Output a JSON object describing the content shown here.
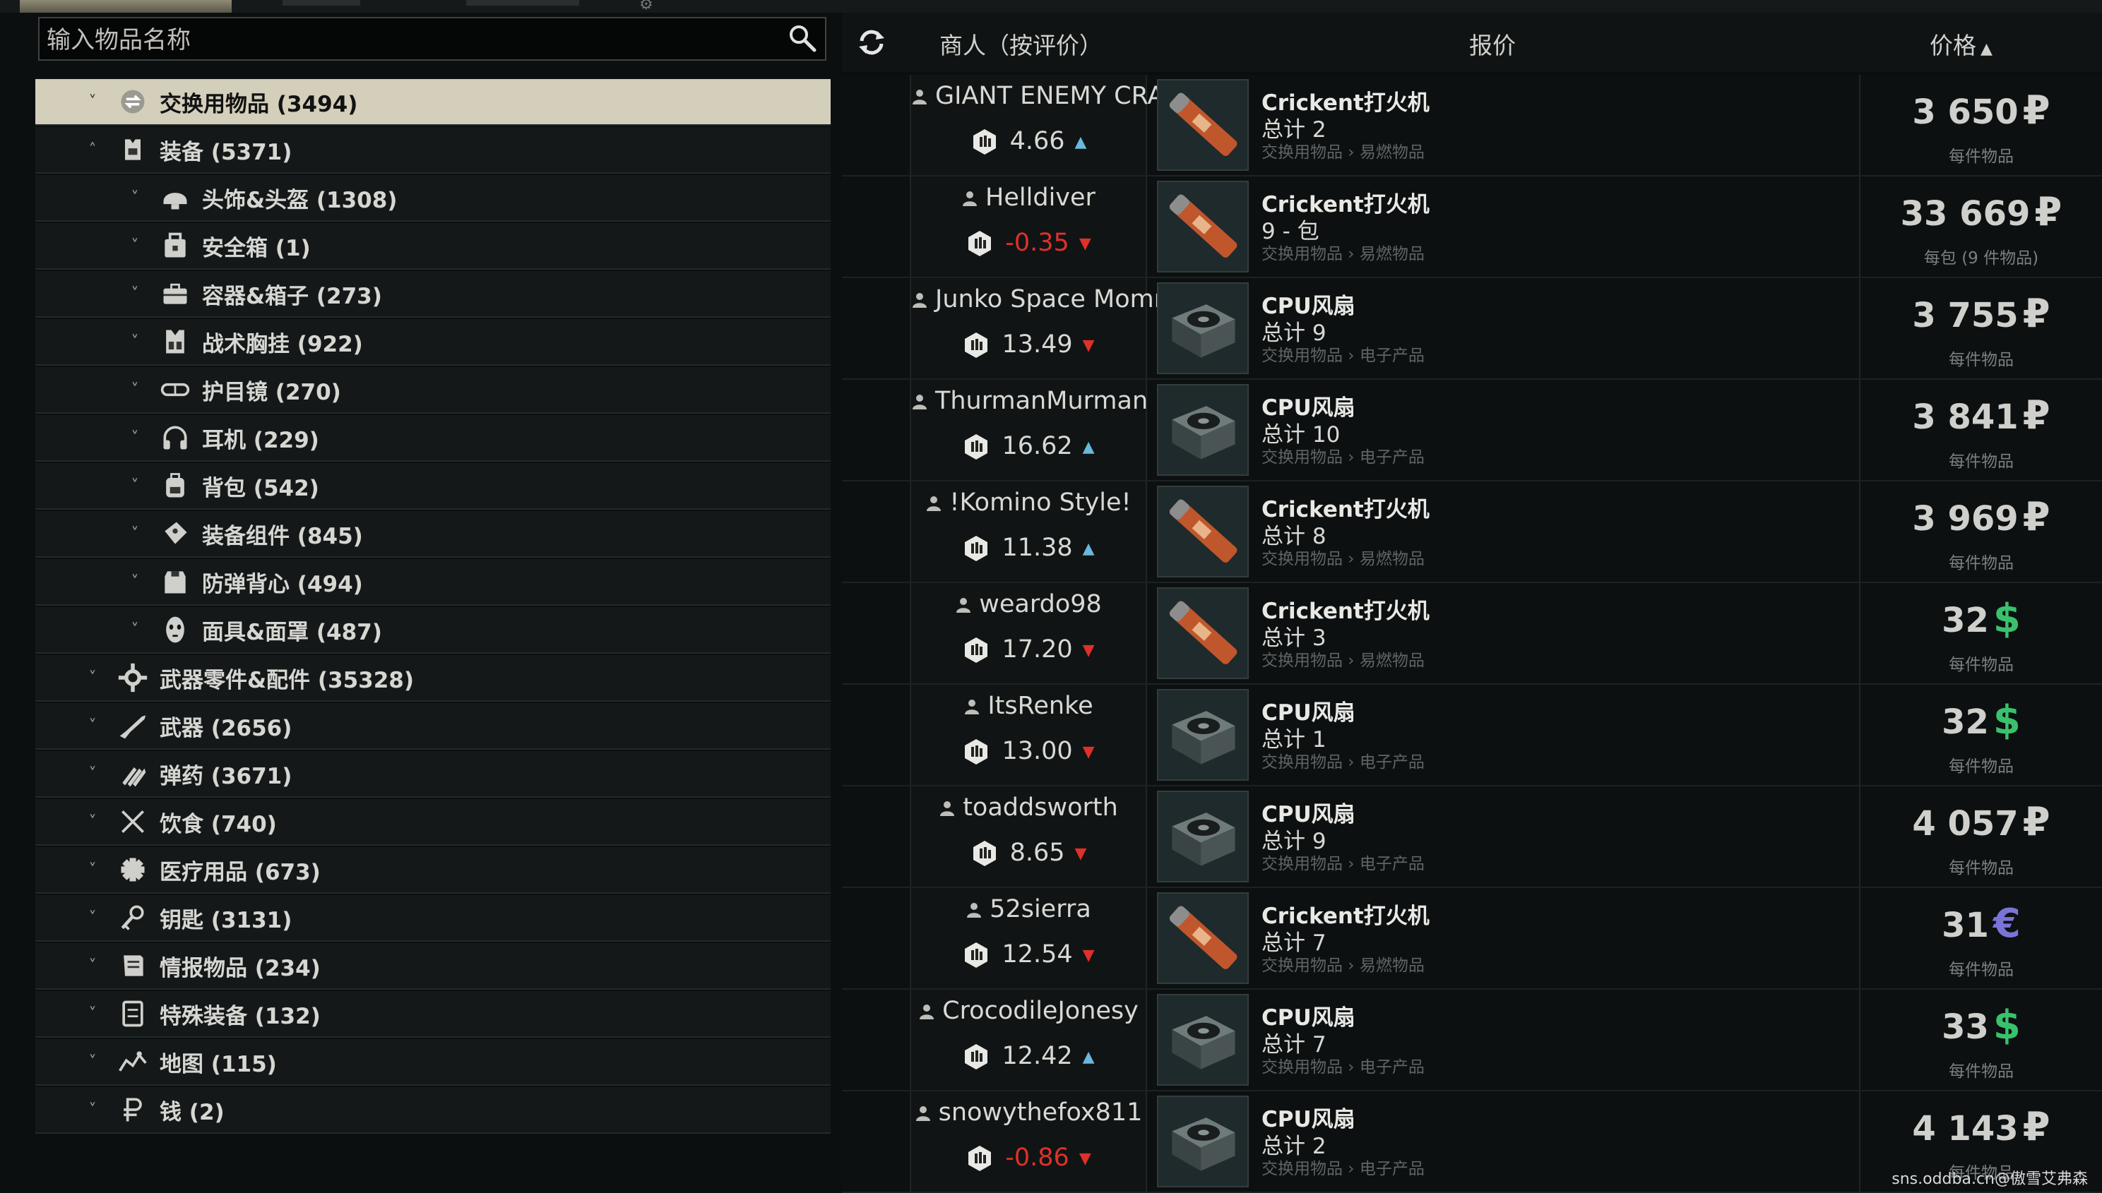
{
  "search": {
    "placeholder": "输入物品名称"
  },
  "categories": [
    {
      "label": "交换用物品 (3494)",
      "icon": "barter-icon",
      "level": 0,
      "expanded": true,
      "selected": true
    },
    {
      "label": "装备 (5371)",
      "icon": "gear-vest-icon",
      "level": 0,
      "expanded": true,
      "selected": false
    },
    {
      "label": "头饰&头盔 (1308)",
      "icon": "helmet-icon",
      "level": 1,
      "expanded": false,
      "selected": false
    },
    {
      "label": "安全箱 (1)",
      "icon": "secure-container-icon",
      "level": 1,
      "expanded": false,
      "selected": false
    },
    {
      "label": "容器&箱子 (273)",
      "icon": "case-icon",
      "level": 1,
      "expanded": false,
      "selected": false
    },
    {
      "label": "战术胸挂 (922)",
      "icon": "chest-rig-icon",
      "level": 1,
      "expanded": false,
      "selected": false
    },
    {
      "label": "护目镜 (270)",
      "icon": "goggles-icon",
      "level": 1,
      "expanded": false,
      "selected": false
    },
    {
      "label": "耳机 (229)",
      "icon": "headset-icon",
      "level": 1,
      "expanded": false,
      "selected": false
    },
    {
      "label": "背包 (542)",
      "icon": "backpack-icon",
      "level": 1,
      "expanded": false,
      "selected": false
    },
    {
      "label": "装备组件 (845)",
      "icon": "gear-component-icon",
      "level": 1,
      "expanded": false,
      "selected": false
    },
    {
      "label": "防弹背心 (494)",
      "icon": "armor-icon",
      "level": 1,
      "expanded": false,
      "selected": false
    },
    {
      "label": "面具&面罩 (487)",
      "icon": "mask-icon",
      "level": 1,
      "expanded": false,
      "selected": false
    },
    {
      "label": "武器零件&配件 (35328)",
      "icon": "weapon-parts-icon",
      "level": 0,
      "expanded": false,
      "selected": false
    },
    {
      "label": "武器 (2656)",
      "icon": "rifle-icon",
      "level": 0,
      "expanded": false,
      "selected": false
    },
    {
      "label": "弹药 (3671)",
      "icon": "ammo-icon",
      "level": 0,
      "expanded": false,
      "selected": false
    },
    {
      "label": "饮食 (740)",
      "icon": "food-icon",
      "level": 0,
      "expanded": false,
      "selected": false
    },
    {
      "label": "医疗用品 (673)",
      "icon": "medical-icon",
      "level": 0,
      "expanded": false,
      "selected": false
    },
    {
      "label": "钥匙 (3131)",
      "icon": "key-icon",
      "level": 0,
      "expanded": false,
      "selected": false
    },
    {
      "label": "情报物品 (234)",
      "icon": "intel-icon",
      "level": 0,
      "expanded": false,
      "selected": false
    },
    {
      "label": "特殊装备 (132)",
      "icon": "special-equipment-icon",
      "level": 0,
      "expanded": false,
      "selected": false
    },
    {
      "label": "地图 (115)",
      "icon": "map-icon",
      "level": 0,
      "expanded": false,
      "selected": false
    },
    {
      "label": "钱 (2)",
      "icon": "ruble-icon",
      "level": 0,
      "expanded": false,
      "selected": false
    }
  ],
  "header": {
    "merchant": "商人（按评价）",
    "offer": "报价",
    "price": "价格",
    "sort_arrow": "▲"
  },
  "offers": [
    {
      "seller": "GIANT ENEMY CRAB",
      "rating": "4.66",
      "trend": "up",
      "negative": false,
      "item": "Crickent打火机",
      "qty": "总计 2",
      "category": "交换用物品 › 易燃物品",
      "thumb": "lighter-thumb",
      "price": "3 650",
      "currency": "₽",
      "currency_kind": "rub",
      "unit": "每件物品"
    },
    {
      "seller": "Helldiver",
      "rating": "-0.35",
      "trend": "down",
      "negative": true,
      "item": "Crickent打火机",
      "qty": "9 - 包",
      "category": "交换用物品 › 易燃物品",
      "thumb": "lighter-thumb",
      "price": "33 669",
      "currency": "₽",
      "currency_kind": "rub",
      "unit": "每包 (9 件物品)"
    },
    {
      "seller": "Junko Space Mommy",
      "rating": "13.49",
      "trend": "down",
      "negative": false,
      "item": "CPU风扇",
      "qty": "总计 9",
      "category": "交换用物品 › 电子产品",
      "thumb": "cpu-fan-thumb",
      "price": "3 755",
      "currency": "₽",
      "currency_kind": "rub",
      "unit": "每件物品"
    },
    {
      "seller": "ThurmanMurman",
      "rating": "16.62",
      "trend": "up",
      "negative": false,
      "item": "CPU风扇",
      "qty": "总计 10",
      "category": "交换用物品 › 电子产品",
      "thumb": "cpu-fan-thumb",
      "price": "3 841",
      "currency": "₽",
      "currency_kind": "rub",
      "unit": "每件物品"
    },
    {
      "seller": "!Komino Style!",
      "rating": "11.38",
      "trend": "up",
      "negative": false,
      "item": "Crickent打火机",
      "qty": "总计 8",
      "category": "交换用物品 › 易燃物品",
      "thumb": "lighter-thumb",
      "price": "3 969",
      "currency": "₽",
      "currency_kind": "rub",
      "unit": "每件物品"
    },
    {
      "seller": "weardo98",
      "rating": "17.20",
      "trend": "down",
      "negative": false,
      "item": "Crickent打火机",
      "qty": "总计 3",
      "category": "交换用物品 › 易燃物品",
      "thumb": "lighter-thumb",
      "price": "32",
      "currency": "$",
      "currency_kind": "usd",
      "unit": "每件物品"
    },
    {
      "seller": "ItsRenke",
      "rating": "13.00",
      "trend": "down",
      "negative": false,
      "item": "CPU风扇",
      "qty": "总计 1",
      "category": "交换用物品 › 电子产品",
      "thumb": "cpu-fan-thumb",
      "price": "32",
      "currency": "$",
      "currency_kind": "usd",
      "unit": "每件物品"
    },
    {
      "seller": "toaddsworth",
      "rating": "8.65",
      "trend": "down",
      "negative": false,
      "item": "CPU风扇",
      "qty": "总计 9",
      "category": "交换用物品 › 电子产品",
      "thumb": "cpu-fan-thumb",
      "price": "4 057",
      "currency": "₽",
      "currency_kind": "rub",
      "unit": "每件物品"
    },
    {
      "seller": "52sierra",
      "rating": "12.54",
      "trend": "down",
      "negative": false,
      "item": "Crickent打火机",
      "qty": "总计 7",
      "category": "交换用物品 › 易燃物品",
      "thumb": "lighter-thumb",
      "price": "31",
      "currency": "€",
      "currency_kind": "eur",
      "unit": "每件物品"
    },
    {
      "seller": "CrocodileJonesy",
      "rating": "12.42",
      "trend": "up",
      "negative": false,
      "item": "CPU风扇",
      "qty": "总计 7",
      "category": "交换用物品 › 电子产品",
      "thumb": "cpu-fan-thumb",
      "price": "33",
      "currency": "$",
      "currency_kind": "usd",
      "unit": "每件物品"
    },
    {
      "seller": "snowythefox811",
      "rating": "-0.86",
      "trend": "down",
      "negative": true,
      "item": "CPU风扇",
      "qty": "总计 2",
      "category": "交换用物品 › 电子产品",
      "thumb": "cpu-fan-thumb",
      "price": "4 143",
      "currency": "₽",
      "currency_kind": "rub",
      "unit": "每件物品"
    }
  ],
  "watermark": "sns.oddba.cn@傲雪艾弗森"
}
